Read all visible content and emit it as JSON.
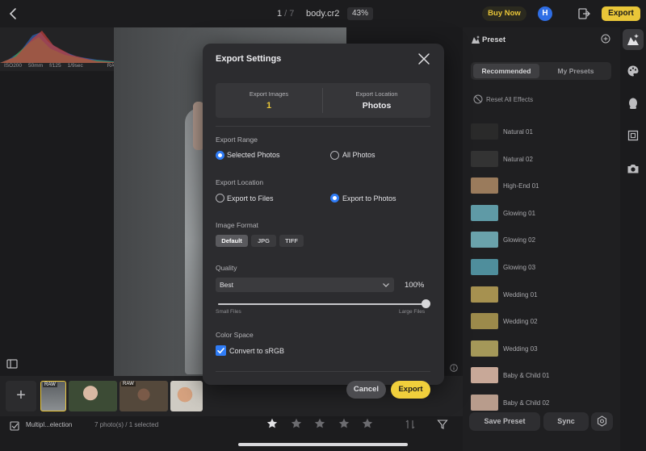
{
  "colors": {
    "accent_yellow": "#e9c638",
    "accent_blue": "#2f7cf6",
    "background": "#1b1b1d",
    "modal": "#2c2c2f"
  },
  "topbar": {
    "back_icon": "chevron-left-icon",
    "counter_current": "1",
    "counter_sep": " / ",
    "counter_total": "7",
    "filename": "body.cr2",
    "zoom": "43%",
    "buy_now": "Buy Now",
    "avatar_initial": "H",
    "export_in_icon": "import-export-icon",
    "export_label": "Export"
  },
  "histogram": {
    "iso": "ISO200",
    "focal": "50mm",
    "aperture": "f/125",
    "shutter": "1/9sec",
    "format": "RAW"
  },
  "filmstrip": {
    "add_label": "+",
    "raw_badge": "RAW"
  },
  "bottombar": {
    "multi_label": "Multipl...election",
    "selection_count": "7 photo(s) / 1 selected",
    "rating": 0,
    "rating_max": 5
  },
  "preset_panel": {
    "title": "Preset",
    "tabs": [
      "Recommended",
      "My Presets"
    ],
    "active_tab": "Recommended",
    "reset_label": "Reset All Effects",
    "presets": [
      {
        "label": "Natural 01",
        "thumb_color": "#2a2a2a"
      },
      {
        "label": "Natural 02",
        "thumb_color": "#333333"
      },
      {
        "label": "High-End 01",
        "thumb_color": "#9a7b5c"
      },
      {
        "label": "Glowing 01",
        "thumb_color": "#5f9aa6"
      },
      {
        "label": "Glowing 02",
        "thumb_color": "#6aa2ab"
      },
      {
        "label": "Glowing 03",
        "thumb_color": "#4f8e9c"
      },
      {
        "label": "Wedding 01",
        "thumb_color": "#a69150"
      },
      {
        "label": "Wedding 02",
        "thumb_color": "#9c8a4b"
      },
      {
        "label": "Wedding 03",
        "thumb_color": "#a49859"
      },
      {
        "label": "Baby & Child 01",
        "thumb_color": "#c8a898"
      },
      {
        "label": "Baby & Child 02",
        "thumb_color": "#b89c8c"
      }
    ],
    "save_preset": "Save Preset",
    "sync": "Sync"
  },
  "export_dialog": {
    "title": "Export Settings",
    "export_images_label": "Export Images",
    "export_images_value": "1",
    "export_location_label": "Export Location",
    "export_location_value": "Photos",
    "range_heading": "Export Range",
    "range_options": [
      "Selected Photos",
      "All Photos"
    ],
    "range_selected": "Selected Photos",
    "location_heading": "Export Location",
    "location_options": [
      "Export to Files",
      "Export to Photos"
    ],
    "location_selected": "Export to Photos",
    "format_heading": "Image Format",
    "formats": [
      "Default",
      "JPG",
      "TIFF"
    ],
    "format_selected": "Default",
    "quality_heading": "Quality",
    "quality_value": "Best",
    "quality_percent": "100%",
    "quality_fraction": 1.0,
    "slider_min_label": "Small Files",
    "slider_max_label": "Large Files",
    "color_space_heading": "Color Space",
    "convert_srgb": "Convert to sRGB",
    "convert_srgb_checked": true,
    "cancel": "Cancel",
    "export": "Export"
  }
}
